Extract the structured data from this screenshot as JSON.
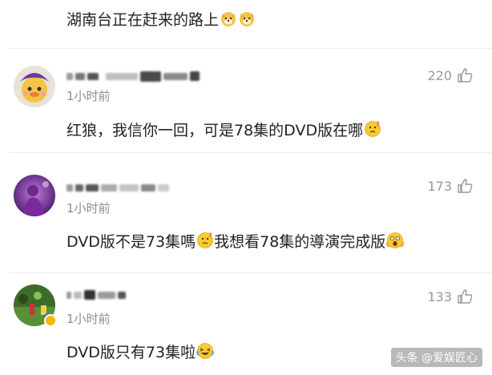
{
  "previous_comment": {
    "text": "湖南台正在赶来的路上"
  },
  "comments": [
    {
      "username_icon": "blurred-username",
      "time": "1小时前",
      "text": "红狼，我信你一回，可是78集的DVD版在哪",
      "likes": "220"
    },
    {
      "username_icon": "blurred-username",
      "time": "1小时前",
      "text": "DVD版不是73集嗎",
      "text2": "我想看78集的導演完成版",
      "likes": "173"
    },
    {
      "username_icon": "blurred-username",
      "time": "1小时前",
      "text": "DVD版只有73集啦",
      "likes": "133",
      "verified": true
    }
  ],
  "watermark": "头条 @爱娱匠心",
  "icons": {
    "like": "thumbs-up-outline-icon",
    "emoji_dog": "doge-emoji-icon",
    "emoji_thinking": "thinking-emoji-icon",
    "emoji_shocked": "shocked-emoji-icon",
    "emoji_laughing": "laughing-tears-emoji-icon"
  },
  "colors": {
    "text": "#222222",
    "meta": "#8c8c8c",
    "like": "#999999",
    "separator": "#ececec",
    "vip_badge": "#f7b500"
  }
}
